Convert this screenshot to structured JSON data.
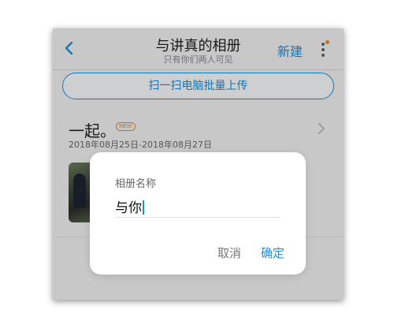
{
  "nav": {
    "back_icon": "chevron-left-icon",
    "title": "与讲真的相册",
    "subtitle": "只有你们两人可见",
    "new_label": "新建",
    "more_icon": "more-vertical-icon"
  },
  "upload": {
    "label": "扫一扫电脑批量上传"
  },
  "album": {
    "title": "一起。",
    "badge": "NEW",
    "date_range": "2018年08月25日-2018年08月27日"
  },
  "dialog": {
    "label": "相册名称",
    "value": "与你",
    "cancel_label": "取消",
    "confirm_label": "确定"
  },
  "colors": {
    "accent": "#1a8fe0",
    "badge": "#f08a2c",
    "background": "#f4f4f4",
    "dialog_bg": "#ffffff"
  }
}
